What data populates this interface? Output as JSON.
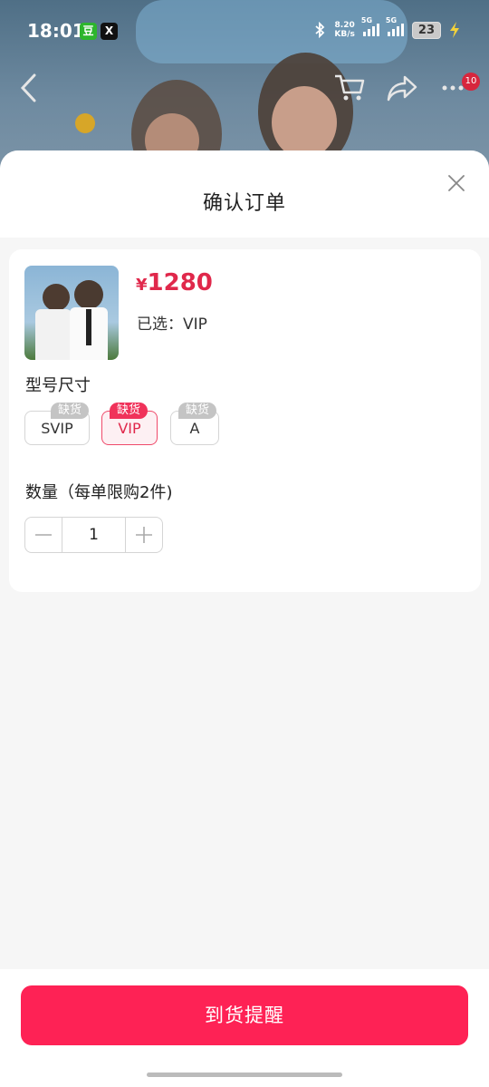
{
  "status_bar": {
    "time": "18:01",
    "app_badge_1": "豆",
    "app_badge_2": "X",
    "net_speed_value": "8.20",
    "net_speed_unit": "KB/s",
    "signal_1": "5G",
    "signal_2": "5G",
    "battery": "23"
  },
  "top_nav": {
    "cart_badge": "10"
  },
  "sheet": {
    "title": "确认订单"
  },
  "product": {
    "currency": "¥",
    "price": "1280",
    "selected_label": "已选：VIP"
  },
  "spec": {
    "label": "型号尺寸",
    "options": [
      {
        "label": "SVIP",
        "tag": "缺货",
        "selected": false
      },
      {
        "label": "VIP",
        "tag": "缺货",
        "selected": true
      },
      {
        "label": "A",
        "tag": "缺货",
        "selected": false
      }
    ]
  },
  "quantity": {
    "label": "数量（每单限购2件)",
    "value": "1"
  },
  "footer": {
    "cta_label": "到货提醒"
  },
  "colors": {
    "accent": "#fe2255",
    "price": "#e0284b"
  }
}
